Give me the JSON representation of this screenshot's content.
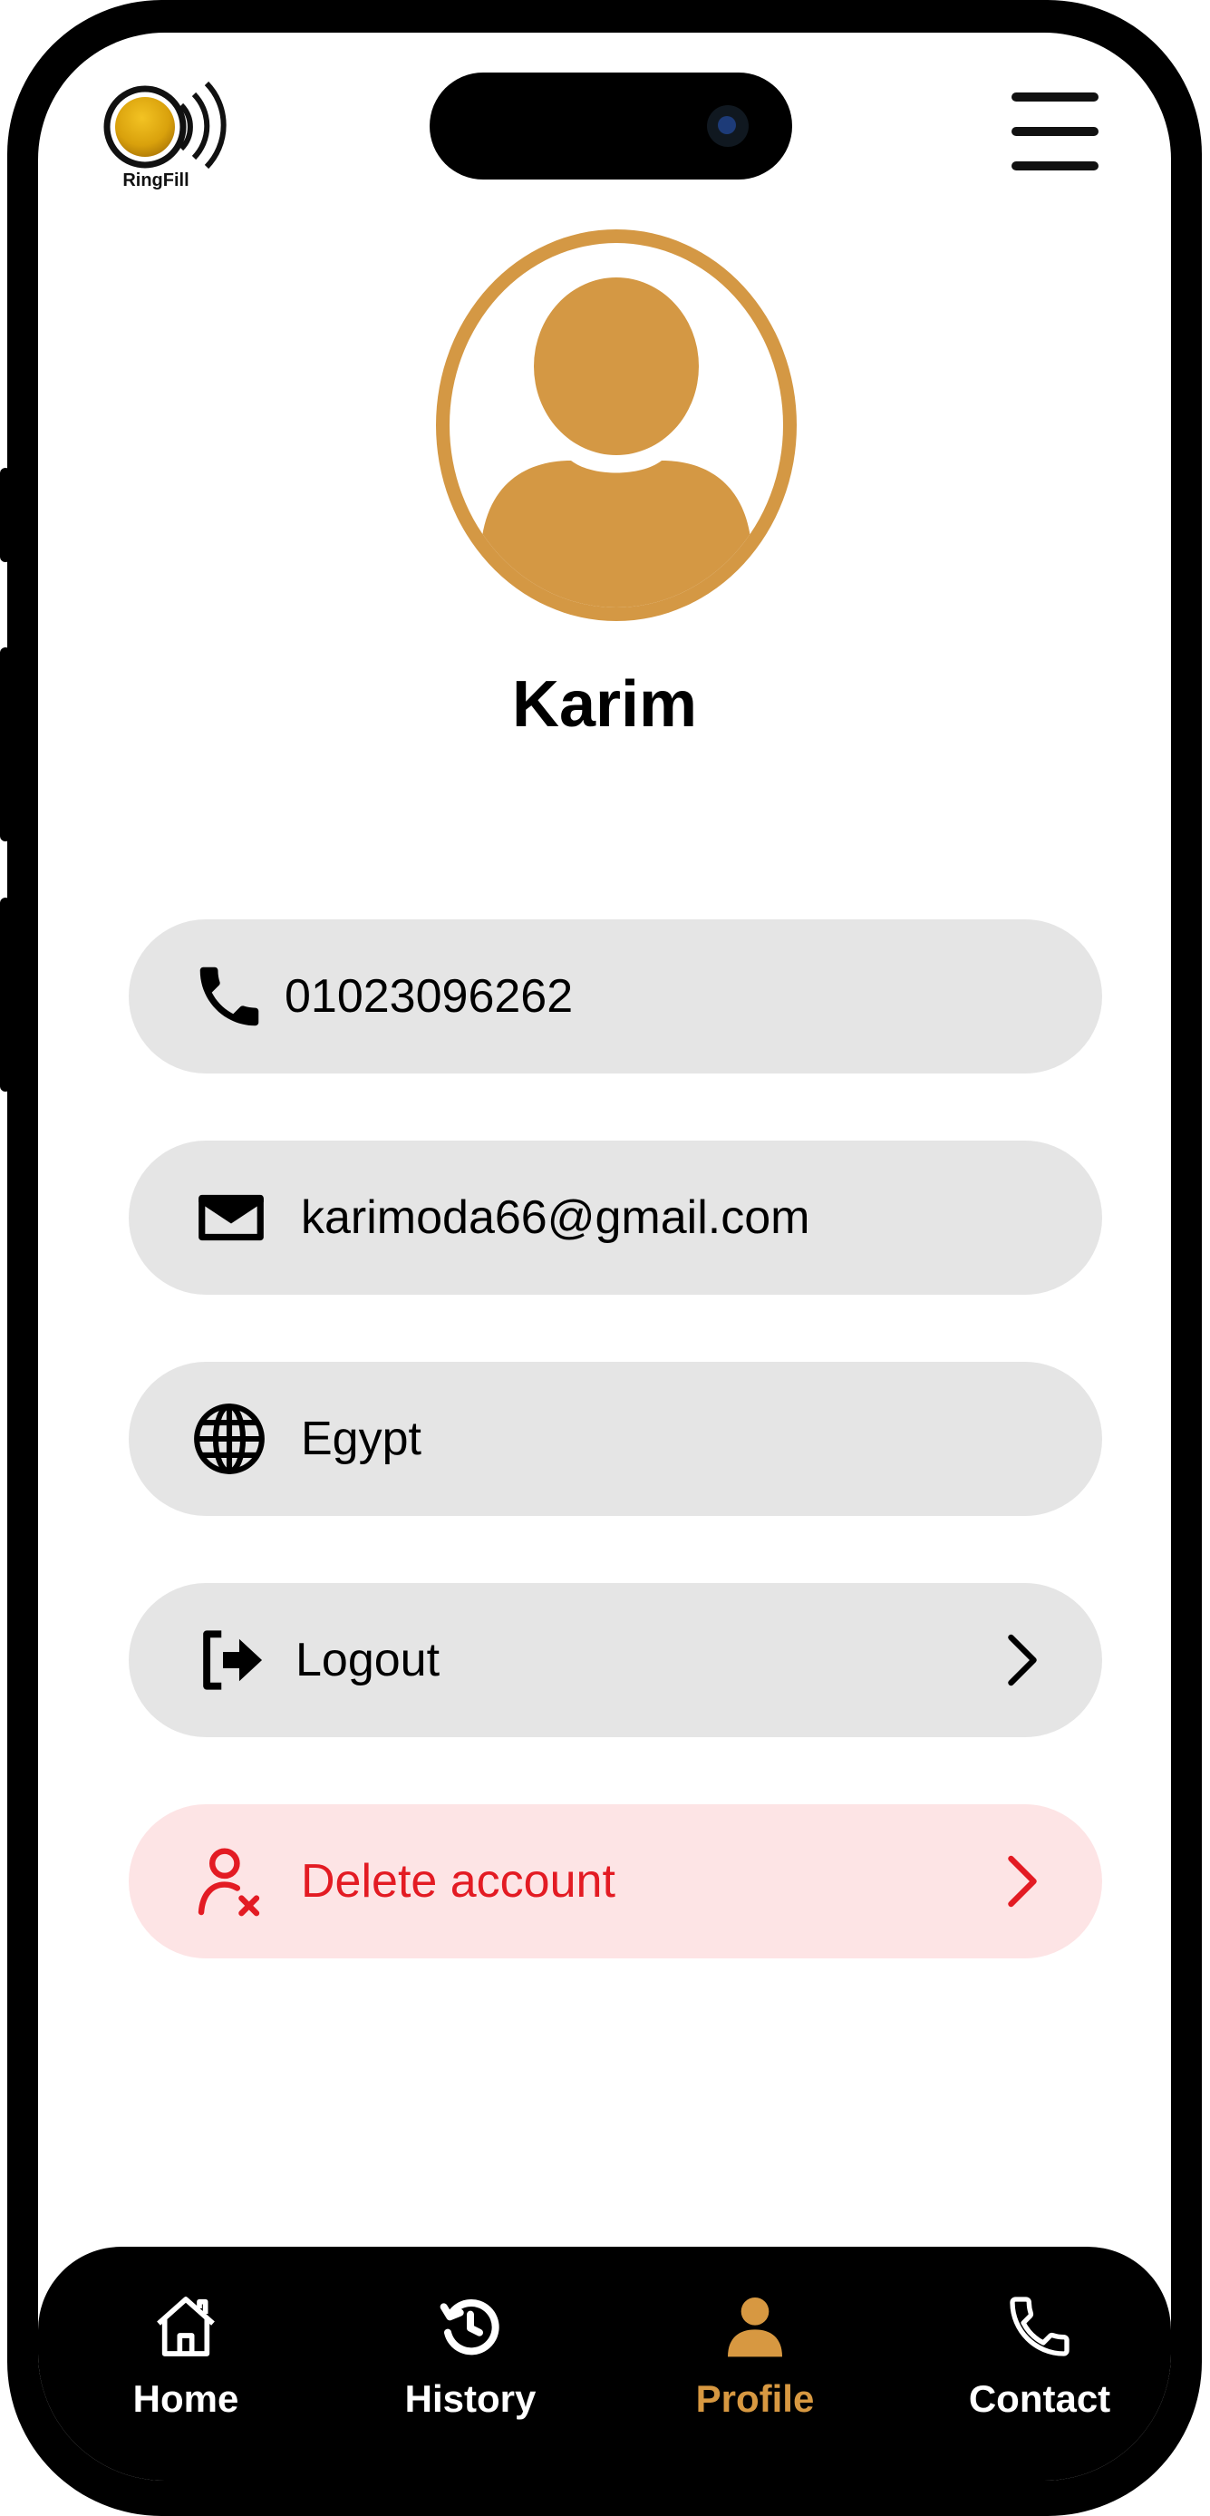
{
  "brand": {
    "name": "RingFill",
    "accent_color": "#d79841",
    "danger_color": "#e31b23"
  },
  "header": {
    "menu_icon": "hamburger-menu-icon"
  },
  "profile": {
    "name": "Karim",
    "avatar_icon": "user-avatar-icon"
  },
  "details": {
    "phone": {
      "icon": "phone-icon",
      "value": "01023096262"
    },
    "email": {
      "icon": "mail-icon",
      "value": "karimoda66@gmail.com"
    },
    "country": {
      "icon": "globe-icon",
      "value": "Egypt"
    }
  },
  "actions": {
    "logout": {
      "icon": "logout-icon",
      "label": "Logout"
    },
    "delete": {
      "icon": "user-remove-icon",
      "label": "Delete account"
    }
  },
  "nav": {
    "active": "Profile",
    "items": [
      {
        "label": "Home",
        "icon": "home-icon"
      },
      {
        "label": "History",
        "icon": "history-icon"
      },
      {
        "label": "Profile",
        "icon": "profile-icon"
      },
      {
        "label": "Contact",
        "icon": "phone-icon"
      }
    ]
  }
}
